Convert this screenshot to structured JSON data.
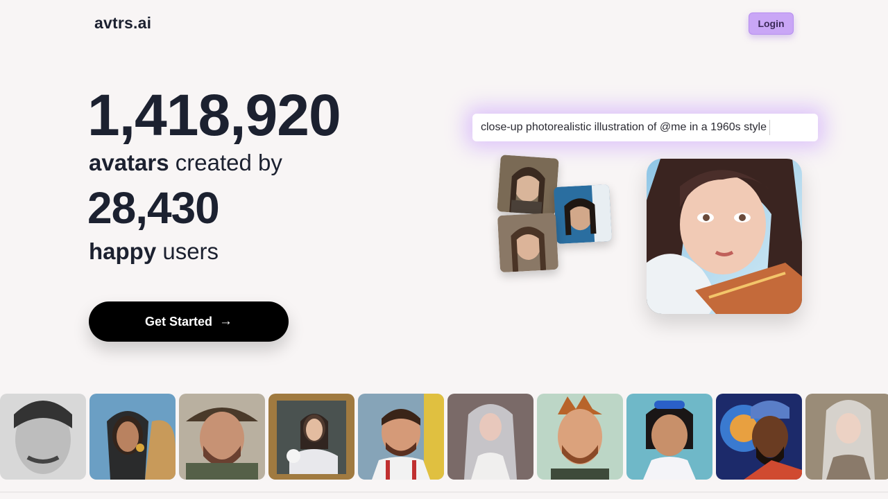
{
  "header": {
    "logo": "avtrs.ai",
    "login_label": "Login"
  },
  "hero": {
    "avatars_count": "1,418,920",
    "avatars_bold": "avatars",
    "avatars_text": " created by",
    "users_count": "28,430",
    "users_bold": "happy",
    "users_text": " users",
    "cta_label": "Get Started",
    "cta_icon": "arrow-right-icon"
  },
  "prompt": {
    "text": "close-up photorealistic illustration of @me in a 1960s style"
  },
  "colors": {
    "background": "#f8f5f5",
    "accent": "#c9a6f6",
    "text": "#1c2130",
    "cta": "#000000"
  },
  "gallery": {
    "tiles": [
      {
        "name": "avatar-tile-bw-man"
      },
      {
        "name": "avatar-tile-woman-camel"
      },
      {
        "name": "avatar-tile-man-hat"
      },
      {
        "name": "avatar-tile-framed-portrait"
      },
      {
        "name": "avatar-tile-man-city"
      },
      {
        "name": "avatar-tile-woman-silver-hair"
      },
      {
        "name": "avatar-tile-cartoon-man"
      },
      {
        "name": "avatar-tile-cartoon-girl"
      },
      {
        "name": "avatar-tile-man-colorful"
      },
      {
        "name": "avatar-tile-woman-fantasy"
      }
    ]
  }
}
